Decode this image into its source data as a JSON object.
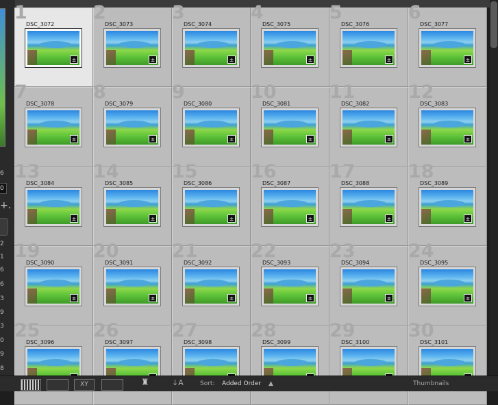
{
  "left_panel": {
    "numbers": [
      "6",
      "2",
      "1",
      "6",
      "6",
      "3",
      "9",
      "3",
      "0",
      "9",
      "8"
    ],
    "field_value": "0",
    "plus_label": "+."
  },
  "grid": {
    "cells": [
      {
        "index": "1",
        "name": "DSC_3072",
        "selected": true
      },
      {
        "index": "2",
        "name": "DSC_3073"
      },
      {
        "index": "3",
        "name": "DSC_3074"
      },
      {
        "index": "4",
        "name": "DSC_3075"
      },
      {
        "index": "5",
        "name": "DSC_3076"
      },
      {
        "index": "6",
        "name": "DSC_3077"
      },
      {
        "index": "7",
        "name": "DSC_3078"
      },
      {
        "index": "8",
        "name": "DSC_3079"
      },
      {
        "index": "9",
        "name": "DSC_3080"
      },
      {
        "index": "10",
        "name": "DSC_3081"
      },
      {
        "index": "11",
        "name": "DSC_3082"
      },
      {
        "index": "12",
        "name": "DSC_3083"
      },
      {
        "index": "13",
        "name": "DSC_3084"
      },
      {
        "index": "14",
        "name": "DSC_3085"
      },
      {
        "index": "15",
        "name": "DSC_3086"
      },
      {
        "index": "16",
        "name": "DSC_3087"
      },
      {
        "index": "17",
        "name": "DSC_3088"
      },
      {
        "index": "18",
        "name": "DSC_3089"
      },
      {
        "index": "19",
        "name": "DSC_3090"
      },
      {
        "index": "20",
        "name": "DSC_3091"
      },
      {
        "index": "21",
        "name": "DSC_3092"
      },
      {
        "index": "22",
        "name": "DSC_3093"
      },
      {
        "index": "23",
        "name": "DSC_3094"
      },
      {
        "index": "24",
        "name": "DSC_3095"
      },
      {
        "index": "25",
        "name": "DSC_3096"
      },
      {
        "index": "26",
        "name": "DSC_3097"
      },
      {
        "index": "27",
        "name": "DSC_3098"
      },
      {
        "index": "28",
        "name": "DSC_3099"
      },
      {
        "index": "29",
        "name": "DSC_3100"
      },
      {
        "index": "30",
        "name": "DSC_3101"
      }
    ],
    "badge_icon": "develop-adjusted-icon"
  },
  "toolbar": {
    "sort_label": "Sort:",
    "sort_value": "Added Order",
    "sort_arrow": "▲",
    "thumbnails_label": "Thumbnails",
    "compare_glyph": "XY"
  }
}
